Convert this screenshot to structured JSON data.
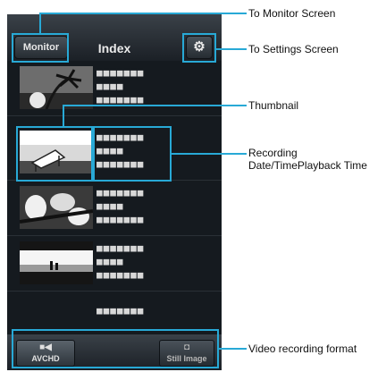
{
  "header": {
    "monitor_label": "Monitor",
    "title": "Index",
    "settings_icon": "gear-icon"
  },
  "rows": [
    {
      "line1": "■■■■■■■",
      "line2": "■■■■",
      "line3": "■■■■■■■"
    },
    {
      "line1": "■■■■■■■",
      "line2": "■■■■",
      "line3": "■■■■■■■"
    },
    {
      "line1": "■■■■■■■",
      "line2": "■■■■",
      "line3": "■■■■■■■"
    },
    {
      "line1": "■■■■■■■",
      "line2": "■■■■",
      "line3": "■■■■■■■"
    },
    {
      "line1": "■■■■■■■"
    }
  ],
  "footer": {
    "avchd_label": "AVCHD",
    "avchd_icon": "video-camera-icon",
    "still_label": "Still Image",
    "still_icon": "camera-icon"
  },
  "callouts": {
    "monitor": "To Monitor Screen",
    "settings": "To Settings Screen",
    "thumbnail": "Thumbnail",
    "recording_1": "Recording",
    "recording_2": "Date/TimePlayback Time",
    "format": "Video recording format"
  },
  "colors": {
    "highlight": "#28a9d6",
    "screen": "#151a1f"
  }
}
